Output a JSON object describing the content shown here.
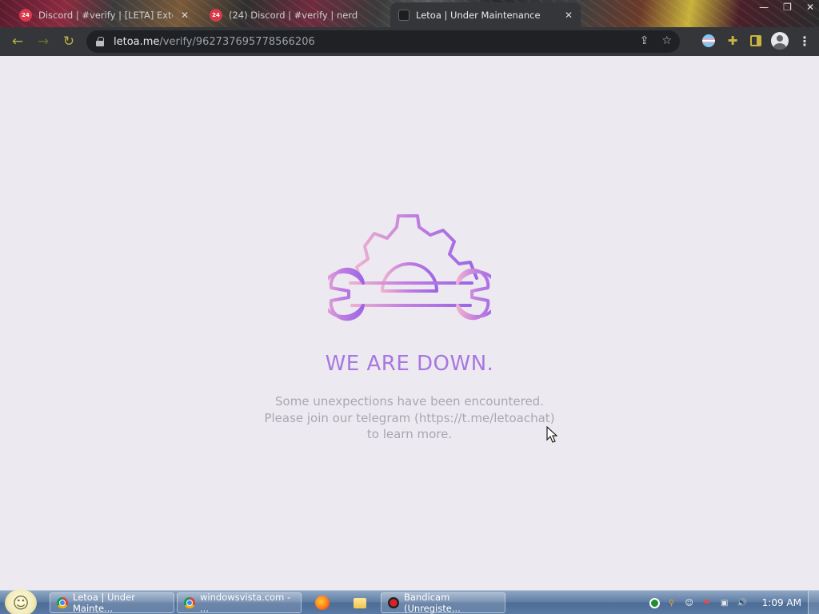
{
  "browser": {
    "tabs": [
      {
        "title": "Discord | #verify | [LETA] Exte",
        "close": "✕"
      },
      {
        "title": "(24) Discord | #verify | nerd",
        "close": "✕"
      },
      {
        "title": "Letoa | Under Maintenance",
        "close": "✕"
      }
    ],
    "favicon_badge": "24",
    "window_controls": {
      "minimize": "—",
      "restore": "❐",
      "close": "✕"
    },
    "nav": {
      "back": "←",
      "forward": "→",
      "reload": "↻"
    },
    "url": {
      "host": "letoa.me",
      "path": "/verify/962737695778566206"
    },
    "toolbar_icons": {
      "share": "⇪",
      "bookmark": "☆",
      "extensions": "✚",
      "menu": "⋮"
    }
  },
  "page": {
    "headline": "WE ARE DOWN.",
    "message_lines": [
      "Some unexpections have been encountered.",
      "Please join our telegram (https://t.me/letoachat)",
      "to learn more."
    ]
  },
  "taskbar": {
    "start_glyph": "☺",
    "items": [
      {
        "label": "Letoa | Under Mainte..."
      },
      {
        "label": "windowsvista.com - ..."
      },
      {
        "label": "Bandicam (Unregiste..."
      }
    ],
    "tray_icons": [
      "⬤",
      "⚲",
      "☺",
      "⚑",
      "▣",
      "🔊"
    ],
    "clock": "1:09 AM"
  },
  "colors": {
    "accent_purple": "#a877e0",
    "accent_pink": "#e7a6cf",
    "message_gray": "#a9a7b0",
    "page_bg": "#ece9f0"
  },
  "icons": {
    "illustration": "gear-wrench-maintenance-icon",
    "lock": "lock-icon",
    "cursor": "mouse-pointer-icon"
  }
}
